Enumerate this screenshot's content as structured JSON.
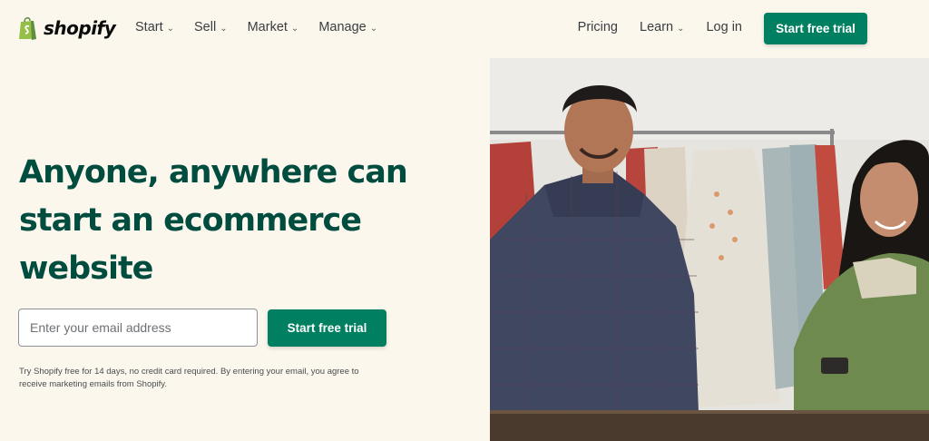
{
  "brand": {
    "name": "shopify",
    "color": "#95bf47"
  },
  "nav": {
    "left": [
      {
        "label": "Start"
      },
      {
        "label": "Sell"
      },
      {
        "label": "Market"
      },
      {
        "label": "Manage"
      }
    ],
    "pricing": "Pricing",
    "learn": "Learn",
    "login": "Log in",
    "cta": "Start free trial"
  },
  "hero": {
    "title_line1": "Anyone, anywhere can",
    "title_line2": "start an ecommerce",
    "title_line3": "website",
    "email_placeholder": "Enter your email address",
    "cta": "Start free trial",
    "disclaimer_line1": "Try Shopify free for 14 days, no credit card required. By entering your email, you agree to",
    "disclaimer_line2": "receive marketing emails from Shopify."
  },
  "colors": {
    "accent": "#008060",
    "heading": "#004c3f",
    "background": "#fbf7ed"
  }
}
